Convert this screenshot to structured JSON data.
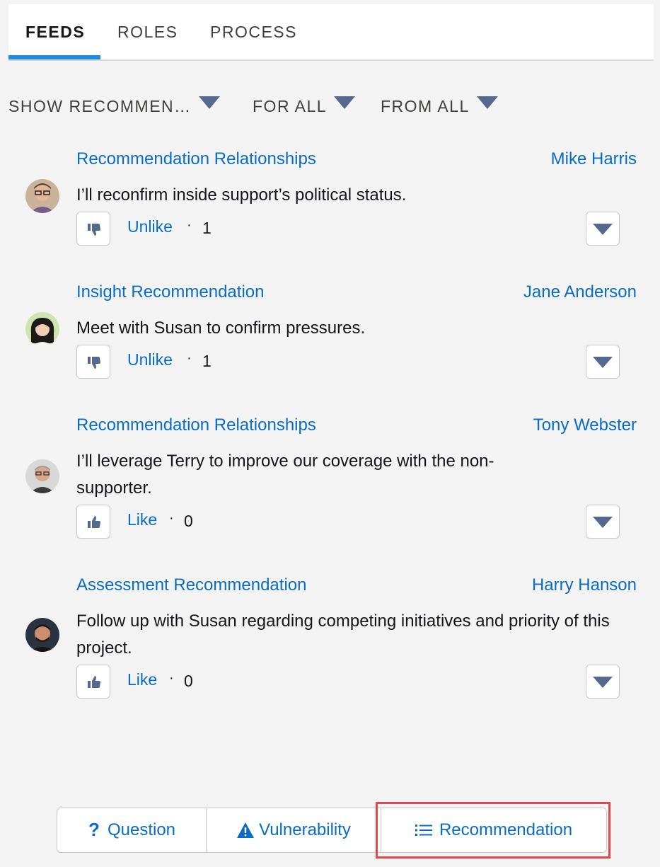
{
  "tabs": [
    {
      "label": "FEEDS",
      "active": true
    },
    {
      "label": "ROLES",
      "active": false
    },
    {
      "label": "PROCESS",
      "active": false
    }
  ],
  "filters": {
    "show": "SHOW RECOMMEN…",
    "for": "FOR ALL",
    "from": "FROM ALL"
  },
  "feed": [
    {
      "type": "Recommendation Relationships",
      "author": "Mike Harris",
      "text": "I’ll reconfirm inside support’s political status.",
      "action": "Unlike",
      "thumb": "thumbs-down-icon",
      "count": "1"
    },
    {
      "type": "Insight Recommendation",
      "author": "Jane Anderson",
      "text": "Meet with Susan to confirm pressures.",
      "action": "Unlike",
      "thumb": "thumbs-down-icon",
      "count": "1"
    },
    {
      "type": "Recommendation Relationships",
      "author": "Tony Webster",
      "text": "I’ll leverage Terry to improve our coverage with the non-supporter.",
      "action": "Like",
      "thumb": "thumbs-up-icon",
      "count": "0"
    },
    {
      "type": "Assessment Recommendation",
      "author": "Harry Hanson",
      "text": "Follow up with Susan regarding competing initiatives and priority of this project.",
      "action": "Like",
      "thumb": "thumbs-up-icon",
      "count": "0"
    }
  ],
  "separator": "·",
  "composer": {
    "question": "Question",
    "vulnerability": "Vulnerability",
    "recommendation": "Recommendation",
    "selected": "Recommendation"
  },
  "colors": {
    "link": "#0a6dc2",
    "tab_underline": "#1b8ae0",
    "icon_gray": "#54698d",
    "highlight": "#e0484f"
  }
}
